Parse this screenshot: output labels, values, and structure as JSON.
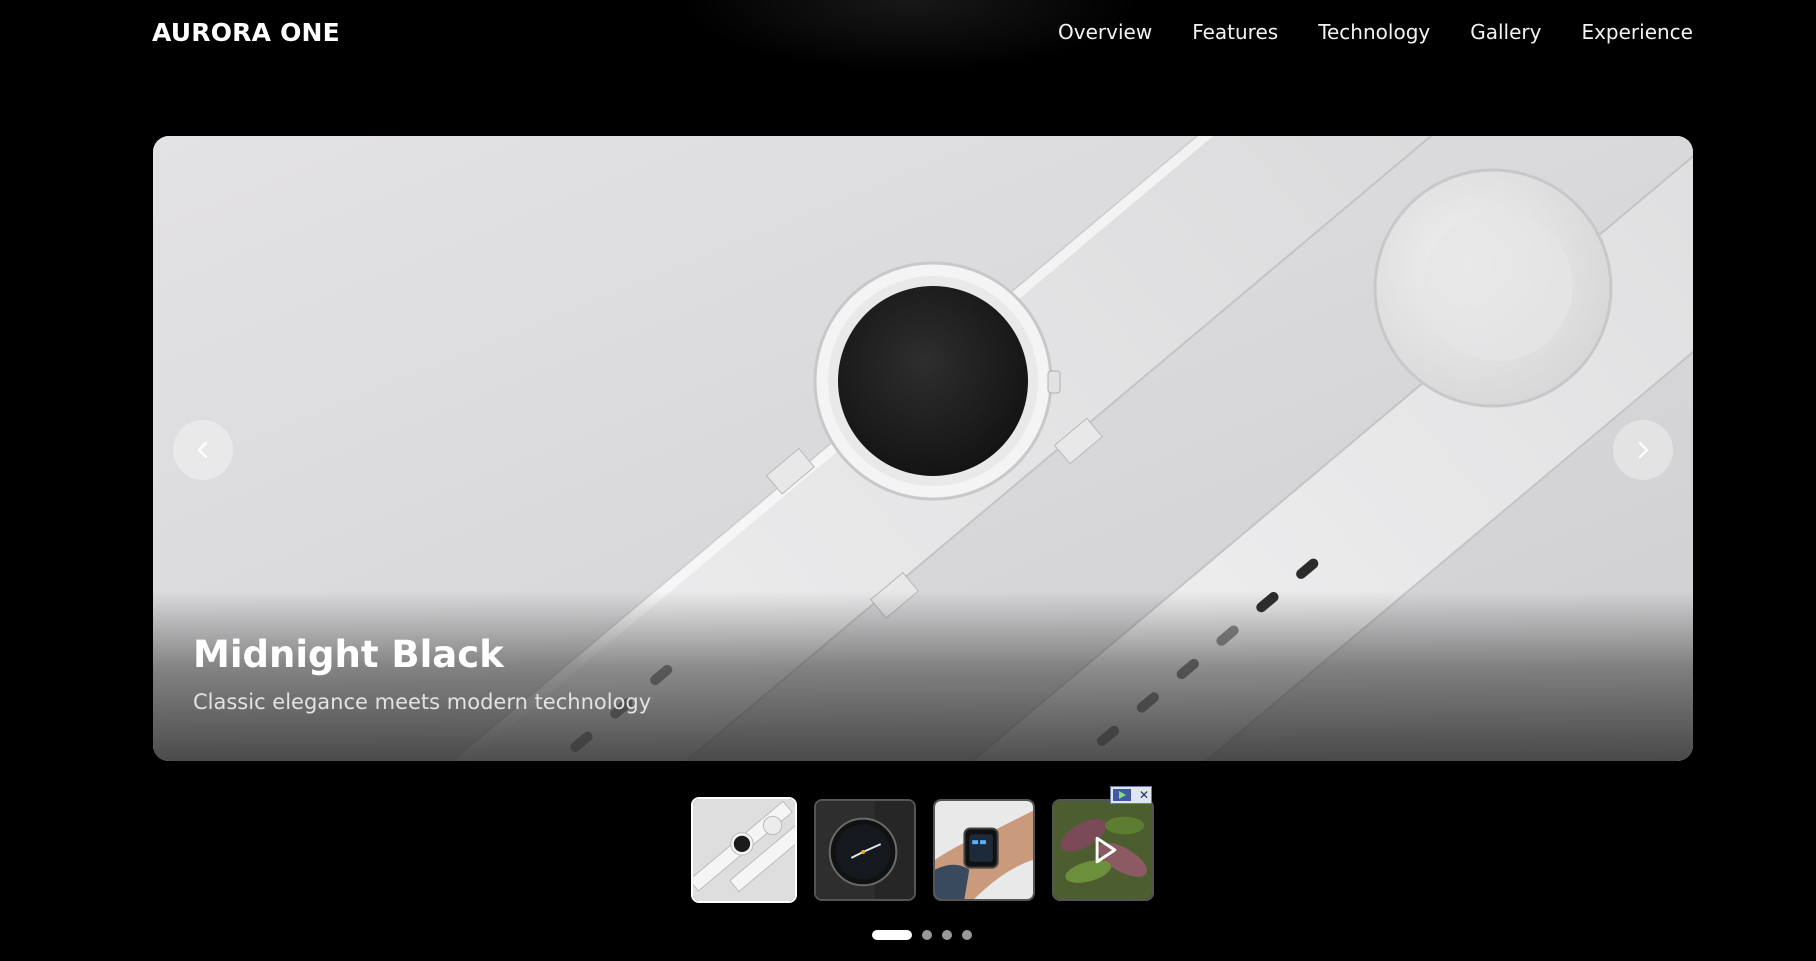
{
  "header": {
    "brand": "AURORA ONE",
    "nav": [
      "Overview",
      "Features",
      "Technology",
      "Gallery",
      "Experience"
    ]
  },
  "hero": {
    "title": "Midnight Black",
    "subtitle": "Classic elegance meets modern technology",
    "prev_icon": "chevron-left-icon",
    "next_icon": "chevron-right-icon"
  },
  "thumbnails": [
    {
      "name": "white-watch-thumb",
      "active": true
    },
    {
      "name": "black-watch-thumb",
      "active": false
    },
    {
      "name": "wrist-smartwatch-thumb",
      "active": false
    },
    {
      "name": "plant-video-thumb",
      "active": false,
      "ad_overlay": true
    }
  ],
  "dots": {
    "count": 4,
    "active_index": 0
  },
  "colors": {
    "background": "#000000",
    "accent": "#ffffff"
  }
}
